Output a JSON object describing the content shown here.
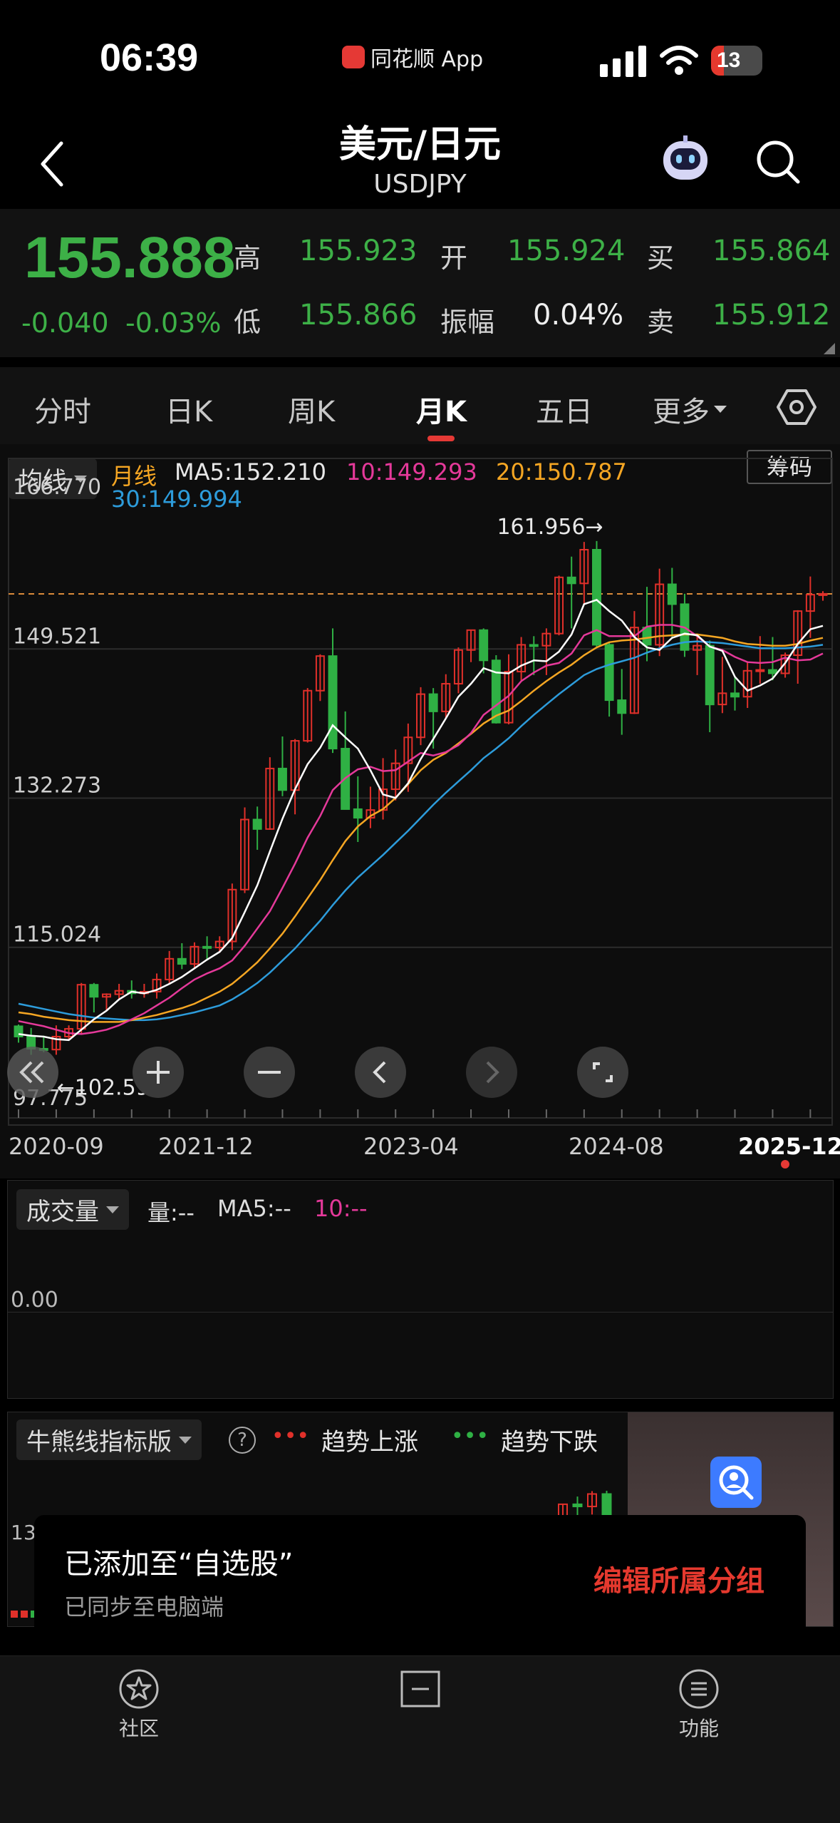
{
  "status_bar": {
    "time": "06:39",
    "app": "同花顺 App",
    "battery": "13"
  },
  "nav": {
    "title": "美元/日元",
    "symbol": "USDJPY"
  },
  "quote": {
    "price": "155.888",
    "change": "-0.040",
    "change_pct": "-0.03%",
    "high_label": "高",
    "high": "155.923",
    "open_label": "开",
    "open": "155.924",
    "buy_label": "买",
    "buy": "155.864",
    "low_label": "低",
    "low": "155.866",
    "amp_label": "振幅",
    "amp": "0.04%",
    "sell_label": "卖",
    "sell": "155.912"
  },
  "tabs": [
    {
      "label": "分时"
    },
    {
      "label": "日K"
    },
    {
      "label": "周K"
    },
    {
      "label": "月K"
    },
    {
      "label": "五日"
    },
    {
      "label": "更多"
    }
  ],
  "ma_row": {
    "select": "均线",
    "period": "月线",
    "ma5": "MA5:152.210",
    "ma10": "10:149.293",
    "ma20": "20:150.787",
    "ma30": "30:149.994",
    "chip_btn": "筹码"
  },
  "chart_data": {
    "type": "candlestick",
    "yticks": [
      "166.770",
      "149.521",
      "132.273",
      "115.024",
      "97.775"
    ],
    "ylim": [
      97.775,
      166.77
    ],
    "xticks": [
      "2020-09",
      "2021-12",
      "2023-04",
      "2024-08",
      "2025-12"
    ],
    "max_label": "161.956→",
    "min_label": "←102.590",
    "ref_line": 155.888,
    "candles": [
      {
        "o": 105.9,
        "h": 106.1,
        "l": 104.0,
        "c": 104.7
      },
      {
        "o": 104.7,
        "h": 105.7,
        "l": 102.6,
        "c": 103.3
      },
      {
        "o": 103.3,
        "h": 104.8,
        "l": 102.9,
        "c": 103.2
      },
      {
        "o": 103.2,
        "h": 106.0,
        "l": 102.6,
        "c": 104.7
      },
      {
        "o": 104.7,
        "h": 106.0,
        "l": 104.4,
        "c": 105.6
      },
      {
        "o": 105.6,
        "h": 110.9,
        "l": 105.0,
        "c": 110.7
      },
      {
        "o": 110.7,
        "h": 110.9,
        "l": 107.5,
        "c": 109.3
      },
      {
        "o": 109.3,
        "h": 109.7,
        "l": 107.7,
        "c": 109.6
      },
      {
        "o": 109.6,
        "h": 110.8,
        "l": 109.1,
        "c": 110.0
      },
      {
        "o": 110.0,
        "h": 111.2,
        "l": 109.1,
        "c": 109.7
      },
      {
        "o": 109.7,
        "h": 110.8,
        "l": 109.2,
        "c": 109.9
      },
      {
        "o": 109.9,
        "h": 112.0,
        "l": 109.1,
        "c": 111.3
      },
      {
        "o": 111.3,
        "h": 114.6,
        "l": 110.8,
        "c": 113.7
      },
      {
        "o": 113.7,
        "h": 115.5,
        "l": 112.5,
        "c": 113.1
      },
      {
        "o": 113.1,
        "h": 115.6,
        "l": 112.6,
        "c": 115.1
      },
      {
        "o": 115.1,
        "h": 116.3,
        "l": 113.5,
        "c": 115.0
      },
      {
        "o": 115.0,
        "h": 116.3,
        "l": 114.4,
        "c": 115.7
      },
      {
        "o": 115.7,
        "h": 122.4,
        "l": 114.7,
        "c": 121.7
      },
      {
        "o": 121.7,
        "h": 131.2,
        "l": 121.3,
        "c": 129.8
      },
      {
        "o": 129.8,
        "h": 131.3,
        "l": 126.3,
        "c": 128.7
      },
      {
        "o": 128.7,
        "h": 137.0,
        "l": 128.6,
        "c": 135.7
      },
      {
        "o": 135.7,
        "h": 139.4,
        "l": 132.5,
        "c": 133.2
      },
      {
        "o": 133.2,
        "h": 139.1,
        "l": 130.4,
        "c": 138.9
      },
      {
        "o": 138.9,
        "h": 145.0,
        "l": 138.7,
        "c": 144.7
      },
      {
        "o": 144.7,
        "h": 148.9,
        "l": 143.5,
        "c": 148.7
      },
      {
        "o": 148.7,
        "h": 151.9,
        "l": 137.5,
        "c": 138.0
      },
      {
        "o": 138.0,
        "h": 142.3,
        "l": 131.0,
        "c": 131.0
      },
      {
        "o": 131.0,
        "h": 134.8,
        "l": 127.2,
        "c": 130.0
      },
      {
        "o": 130.0,
        "h": 133.6,
        "l": 128.8,
        "c": 130.9
      },
      {
        "o": 130.9,
        "h": 136.9,
        "l": 129.8,
        "c": 133.3
      },
      {
        "o": 133.3,
        "h": 137.9,
        "l": 132.0,
        "c": 136.3
      },
      {
        "o": 136.3,
        "h": 140.9,
        "l": 133.0,
        "c": 139.3
      },
      {
        "o": 139.3,
        "h": 145.1,
        "l": 138.4,
        "c": 144.3
      },
      {
        "o": 144.3,
        "h": 145.0,
        "l": 138.0,
        "c": 142.3
      },
      {
        "o": 142.3,
        "h": 146.6,
        "l": 141.5,
        "c": 145.5
      },
      {
        "o": 145.5,
        "h": 149.7,
        "l": 144.4,
        "c": 149.4
      },
      {
        "o": 149.4,
        "h": 151.7,
        "l": 148.0,
        "c": 151.7
      },
      {
        "o": 151.7,
        "h": 151.9,
        "l": 146.7,
        "c": 148.2
      },
      {
        "o": 148.2,
        "h": 148.8,
        "l": 140.9,
        "c": 141.0
      },
      {
        "o": 141.0,
        "h": 148.9,
        "l": 140.8,
        "c": 146.9
      },
      {
        "o": 146.9,
        "h": 150.9,
        "l": 145.9,
        "c": 150.0
      },
      {
        "o": 150.0,
        "h": 151.0,
        "l": 146.5,
        "c": 149.9
      },
      {
        "o": 149.9,
        "h": 151.9,
        "l": 146.5,
        "c": 151.3
      },
      {
        "o": 151.3,
        "h": 158.0,
        "l": 151.1,
        "c": 157.8
      },
      {
        "o": 157.8,
        "h": 160.2,
        "l": 151.9,
        "c": 157.1
      },
      {
        "o": 157.1,
        "h": 161.9,
        "l": 154.6,
        "c": 161.0
      },
      {
        "o": 161.0,
        "h": 162.0,
        "l": 149.6,
        "c": 150.0
      },
      {
        "o": 150.0,
        "h": 150.2,
        "l": 141.7,
        "c": 143.6
      },
      {
        "o": 143.6,
        "h": 147.2,
        "l": 139.6,
        "c": 142.1
      },
      {
        "o": 142.1,
        "h": 153.9,
        "l": 142.0,
        "c": 152.0
      },
      {
        "o": 152.0,
        "h": 156.7,
        "l": 148.1,
        "c": 150.0
      },
      {
        "o": 150.0,
        "h": 158.8,
        "l": 148.7,
        "c": 157.0
      },
      {
        "o": 157.0,
        "h": 158.9,
        "l": 150.9,
        "c": 154.7
      },
      {
        "o": 154.7,
        "h": 155.9,
        "l": 148.6,
        "c": 149.4
      },
      {
        "o": 149.4,
        "h": 151.3,
        "l": 146.5,
        "c": 149.9
      },
      {
        "o": 149.9,
        "h": 150.5,
        "l": 139.9,
        "c": 143.1
      },
      {
        "o": 143.1,
        "h": 148.6,
        "l": 142.1,
        "c": 144.4
      },
      {
        "o": 144.4,
        "h": 146.3,
        "l": 142.4,
        "c": 144.0
      },
      {
        "o": 144.0,
        "h": 148.0,
        "l": 142.7,
        "c": 147.0
      },
      {
        "o": 147.0,
        "h": 151.0,
        "l": 145.5,
        "c": 147.1
      },
      {
        "o": 147.1,
        "h": 150.9,
        "l": 145.9,
        "c": 146.7
      },
      {
        "o": 146.7,
        "h": 149.1,
        "l": 146.2,
        "c": 148.8
      },
      {
        "o": 148.8,
        "h": 154.0,
        "l": 145.5,
        "c": 153.9
      },
      {
        "o": 153.9,
        "h": 157.9,
        "l": 150.8,
        "c": 155.8
      },
      {
        "o": 155.8,
        "h": 156.2,
        "l": 155.1,
        "c": 155.9
      }
    ],
    "ma5": [
      105.0,
      104.8,
      104.7,
      104.4,
      104.3,
      105.5,
      106.7,
      107.7,
      109.0,
      109.9,
      109.7,
      110.1,
      110.8,
      111.6,
      112.6,
      113.6,
      114.5,
      116.1,
      119.1,
      122.2,
      126.1,
      129.9,
      133.3,
      136.2,
      138.1,
      140.7,
      139.3,
      138.0,
      135.5,
      132.7,
      132.3,
      134.0,
      136.8,
      139.1,
      141.5,
      144.0,
      145.5,
      147.3,
      146.8,
      146.7,
      147.6,
      148.2,
      148.1,
      149.2,
      151.2,
      154.7,
      155.2,
      153.9,
      152.8,
      150.9,
      149.7,
      149.4,
      150.8,
      151.3,
      151.1,
      149.8,
      149.3,
      146.3,
      144.7,
      145.3,
      146.1,
      147.9,
      150.1,
      151.8,
      152.2
    ],
    "ma10": [
      106.5,
      106.2,
      105.9,
      105.5,
      105.1,
      105.0,
      105.2,
      105.5,
      106.0,
      106.7,
      107.4,
      108.3,
      109.2,
      110.3,
      111.3,
      112.0,
      112.6,
      113.5,
      115.2,
      117.2,
      119.2,
      121.9,
      124.7,
      127.7,
      130.2,
      133.2,
      134.6,
      135.6,
      135.9,
      135.4,
      135.5,
      136.5,
      137.5,
      137.2,
      137.6,
      138.4,
      139.8,
      141.9,
      143.0,
      144.1,
      145.8,
      146.8,
      147.6,
      147.9,
      149.0,
      151.1,
      151.7,
      151.0,
      151.0,
      151.0,
      152.1,
      152.3,
      152.3,
      152.0,
      151.0,
      149.8,
      149.4,
      148.6,
      148.0,
      147.9,
      148.0,
      148.5,
      148.2,
      148.3,
      149.0
    ],
    "ma20": [
      107.5,
      107.3,
      107.0,
      106.8,
      106.6,
      106.5,
      106.4,
      106.4,
      106.4,
      106.6,
      106.9,
      107.2,
      107.6,
      108.0,
      108.5,
      109.2,
      109.9,
      110.8,
      112.0,
      113.3,
      114.9,
      116.6,
      118.6,
      120.7,
      122.8,
      125.1,
      127.3,
      129.0,
      130.2,
      131.0,
      132.3,
      133.9,
      135.5,
      136.7,
      137.5,
      138.6,
      139.7,
      140.9,
      141.8,
      142.4,
      143.5,
      144.7,
      145.8,
      146.8,
      147.7,
      148.8,
      149.7,
      150.3,
      150.5,
      150.6,
      150.8,
      151.0,
      151.1,
      151.2,
      151.2,
      151.0,
      150.8,
      150.4,
      150.1,
      150.0,
      149.9,
      149.9,
      150.1,
      150.5,
      150.8
    ],
    "ma30": [
      108.5,
      108.2,
      107.9,
      107.6,
      107.3,
      107.1,
      106.9,
      106.8,
      106.7,
      106.6,
      106.6,
      106.7,
      106.9,
      107.2,
      107.5,
      107.9,
      108.3,
      109.0,
      109.9,
      110.9,
      112.1,
      113.5,
      114.9,
      116.5,
      118.1,
      119.9,
      121.6,
      123.1,
      124.4,
      125.7,
      127.1,
      128.5,
      130.0,
      131.5,
      132.9,
      134.2,
      135.5,
      136.9,
      138.0,
      139.2,
      140.6,
      141.9,
      143.1,
      144.3,
      145.4,
      146.5,
      147.2,
      147.7,
      148.1,
      148.5,
      149.1,
      149.6,
      150.0,
      150.3,
      150.4,
      150.3,
      150.2,
      150.0,
      149.8,
      149.6,
      149.6,
      149.6,
      149.7,
      149.8,
      150.0
    ],
    "colors": {
      "up": "#e0302a",
      "down": "#2fb044",
      "ma5": "#ffffff",
      "ma10": "#e5399a",
      "ma20": "#f5a623",
      "ma30": "#2d9cdb",
      "ref": "#d98a3a"
    }
  },
  "volume": {
    "select": "成交量",
    "label": "量:--",
    "ma5": "MA5:--",
    "ma10": "10:--",
    "zero": "0.00"
  },
  "indicator": {
    "select": "牛熊线指标版",
    "up_label": "趋势上涨",
    "down_label": "趋势下跌",
    "dots": "•••",
    "axis_partial": "13"
  },
  "toast": {
    "title": "已添加至“自选股”",
    "subtitle": "已同步至电脑端",
    "action": "编辑所属分组"
  },
  "bottom_nav": [
    {
      "label": "社区"
    },
    {
      "label": ""
    },
    {
      "label": "功能"
    }
  ]
}
